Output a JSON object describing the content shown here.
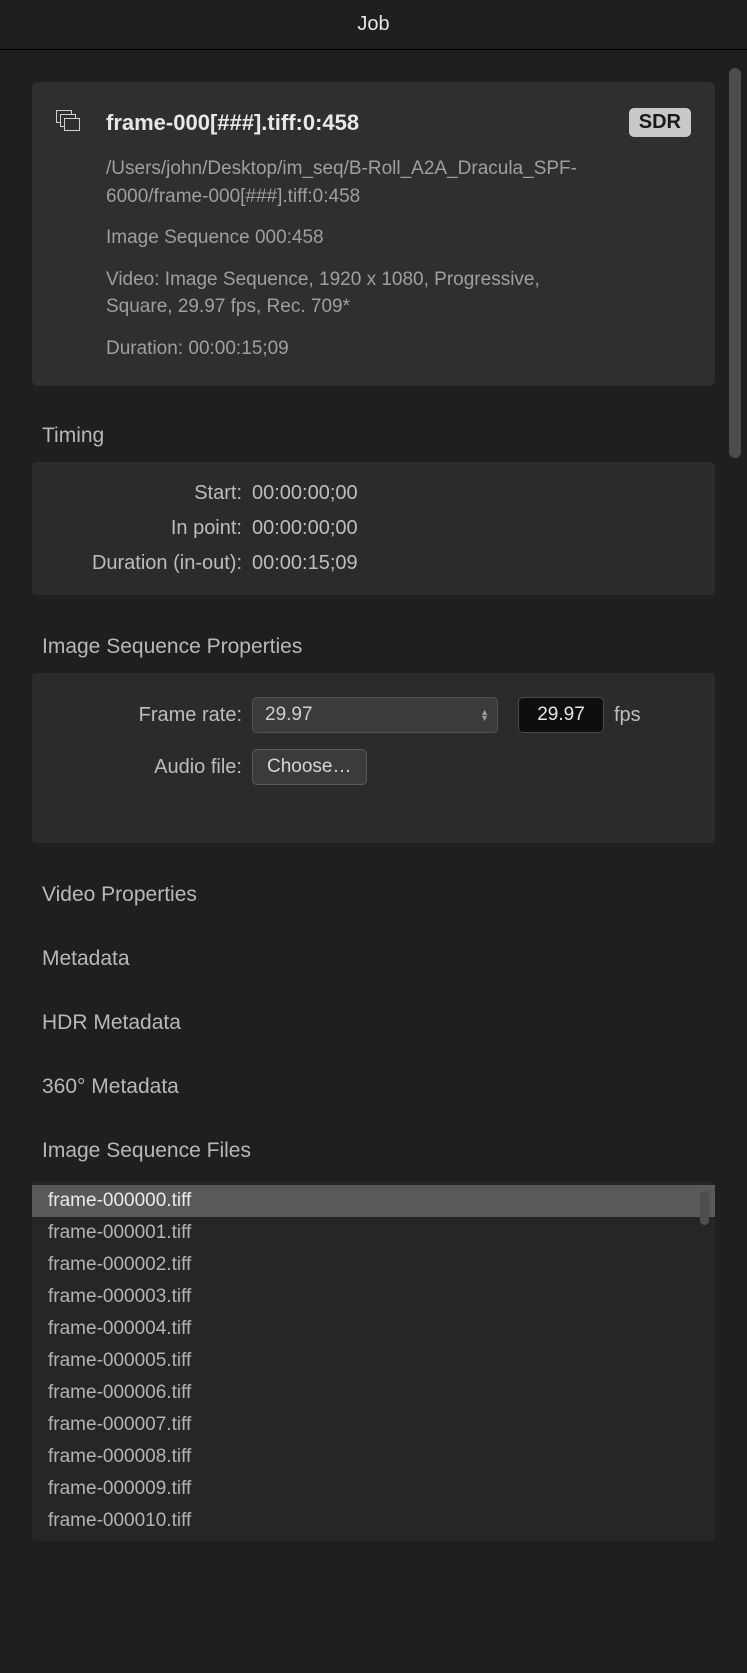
{
  "title": "Job",
  "job": {
    "filename": "frame-000[###].tiff:0:458",
    "badge": "SDR",
    "path": "/Users/john/Desktop/im_seq/B-Roll_A2A_Dracula_SPF-6000/frame-000[###].tiff:0:458",
    "sequence": "Image Sequence 000:458",
    "video": "Video: Image Sequence, 1920 x 1080, Progressive, Square, 29.97 fps, Rec. 709*",
    "duration": "Duration: 00:00:15;09"
  },
  "timing": {
    "title": "Timing",
    "start_label": "Start:",
    "start": "00:00:00;00",
    "in_label": "In point:",
    "in": "00:00:00;00",
    "dur_label": "Duration (in-out):",
    "dur": "00:00:15;09"
  },
  "imgseq": {
    "title": "Image Sequence Properties",
    "framerate_label": "Frame rate:",
    "framerate_select": "29.97",
    "framerate_value": "29.97",
    "fps": "fps",
    "audio_label": "Audio file:",
    "choose": "Choose…"
  },
  "sections": {
    "video": "Video Properties",
    "metadata": "Metadata",
    "hdr": "HDR Metadata",
    "deg360": "360° Metadata",
    "files": "Image Sequence Files"
  },
  "files": [
    "frame-000000.tiff",
    "frame-000001.tiff",
    "frame-000002.tiff",
    "frame-000003.tiff",
    "frame-000004.tiff",
    "frame-000005.tiff",
    "frame-000006.tiff",
    "frame-000007.tiff",
    "frame-000008.tiff",
    "frame-000009.tiff",
    "frame-000010.tiff"
  ]
}
